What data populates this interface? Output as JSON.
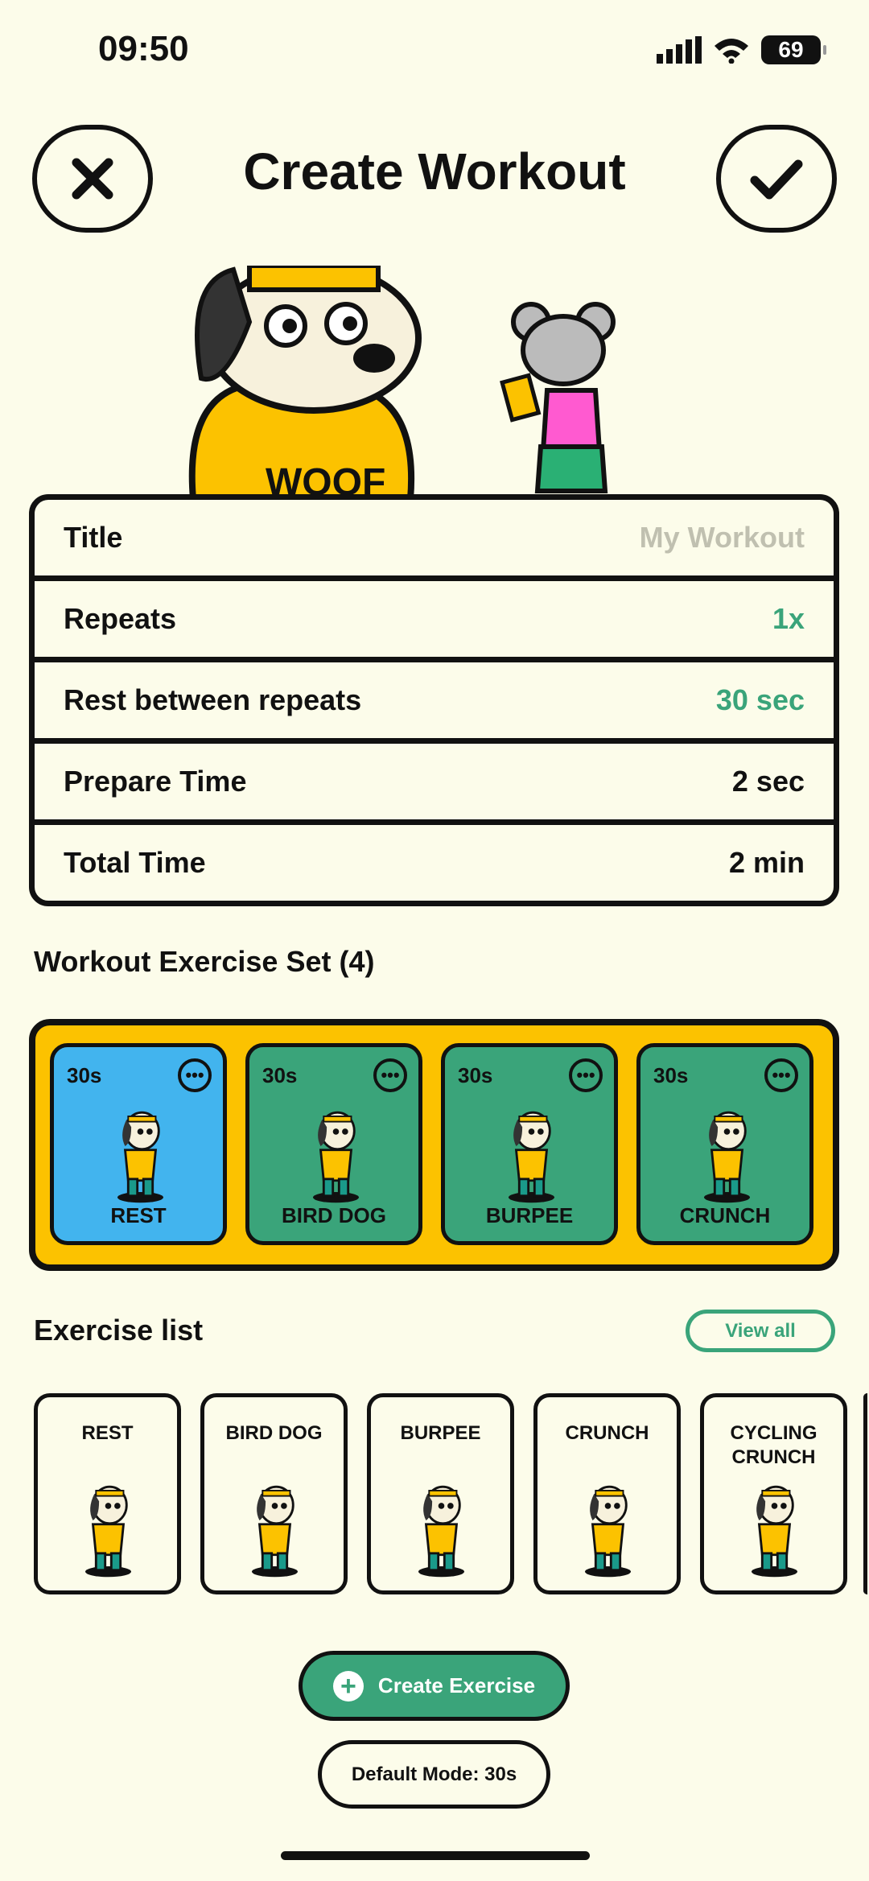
{
  "status": {
    "time": "09:50",
    "battery": "69"
  },
  "header": {
    "title": "Create Workout",
    "close_icon": "close-icon",
    "confirm_icon": "check-icon"
  },
  "settings": [
    {
      "label": "Title",
      "value": "My Workout",
      "style": "placeholder"
    },
    {
      "label": "Repeats",
      "value": "1x",
      "style": "green"
    },
    {
      "label": "Rest between repeats",
      "value": "30 sec",
      "style": "green"
    },
    {
      "label": "Prepare Time",
      "value": "2 sec",
      "style": "normal"
    },
    {
      "label": "Total Time",
      "value": "2 min",
      "style": "normal"
    }
  ],
  "exercise_set": {
    "title": "Workout Exercise Set (4)",
    "items": [
      {
        "duration": "30s",
        "name": "REST",
        "color": "#42b4ee"
      },
      {
        "duration": "30s",
        "name": "BIRD DOG",
        "color": "#3aa47a"
      },
      {
        "duration": "30s",
        "name": "BURPEE",
        "color": "#3aa47a"
      },
      {
        "duration": "30s",
        "name": "CRUNCH",
        "color": "#3aa47a"
      }
    ]
  },
  "exercise_list": {
    "title": "Exercise list",
    "view_all": "View all",
    "items": [
      {
        "name": "REST"
      },
      {
        "name": "BIRD DOG"
      },
      {
        "name": "BURPEE"
      },
      {
        "name": "CRUNCH"
      },
      {
        "name": "CYCLING CRUNCH"
      }
    ]
  },
  "actions": {
    "create_exercise": "Create Exercise",
    "default_mode": "Default Mode: 30s"
  },
  "colors": {
    "background": "#fcfcea",
    "green": "#3aa47a",
    "blue": "#42b4ee",
    "yellow": "#fcc200"
  }
}
